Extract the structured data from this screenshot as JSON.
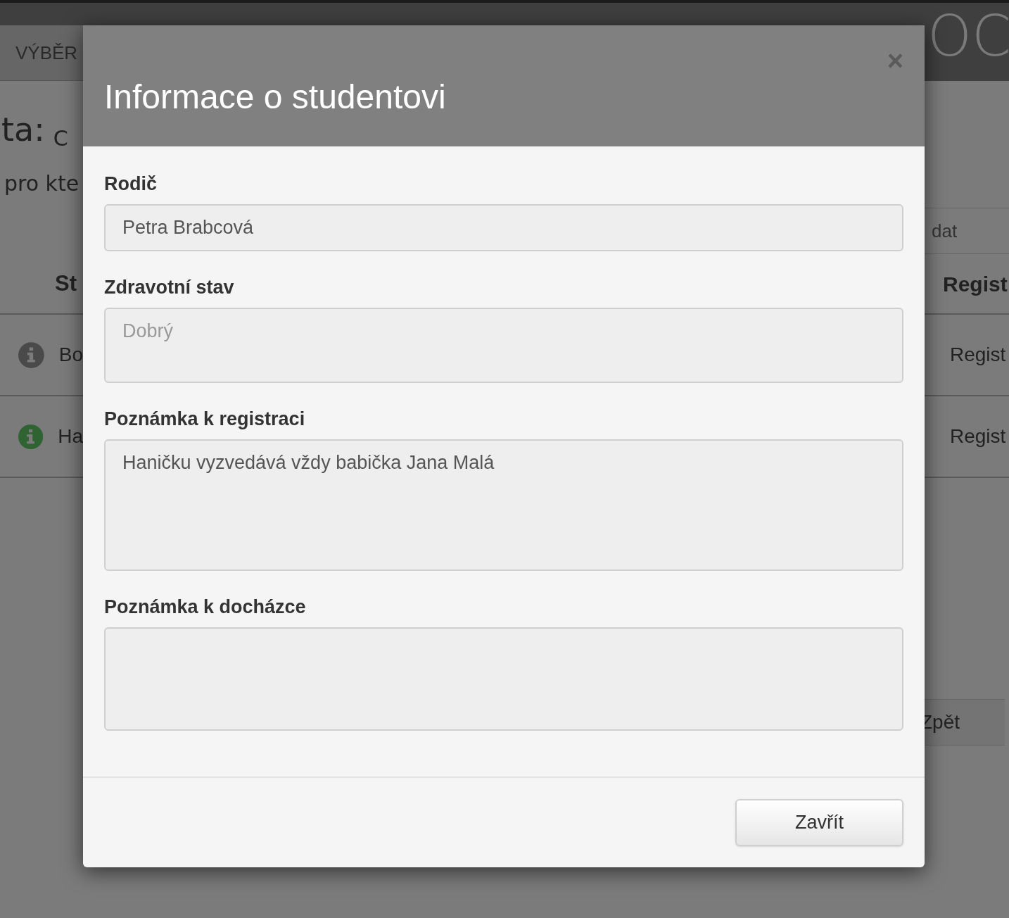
{
  "background": {
    "nav_tab": "VÝBĚR",
    "logo": "OC",
    "heading": "ta:",
    "heading_value": "C",
    "subtitle": "pro kte",
    "search_fragment": "dat",
    "table": {
      "columns": [
        "St",
        "Regist"
      ],
      "rows": [
        {
          "color": "#4a4a4a",
          "cells": [
            "Bo",
            "Regist"
          ]
        },
        {
          "color": "#2f6331",
          "cells": [
            "Ha",
            "Regist"
          ]
        }
      ]
    },
    "back_button": "Zpět"
  },
  "dialog": {
    "title": "Informace o studentovi",
    "close": "×",
    "fields": [
      {
        "label": "Rodič",
        "kind": "input",
        "value": "Petra Brabcová"
      },
      {
        "label": "Zdravotní stav",
        "kind": "textarea",
        "placeholder": "Dobrý"
      },
      {
        "label": "Poznámka k registraci",
        "kind": "textarea",
        "value": "Haničku vyzvedává vždy babička Jana Malá"
      },
      {
        "label": "Poznámka k docházce",
        "kind": "textarea"
      }
    ],
    "buttons": [
      "Zavřít"
    ]
  }
}
